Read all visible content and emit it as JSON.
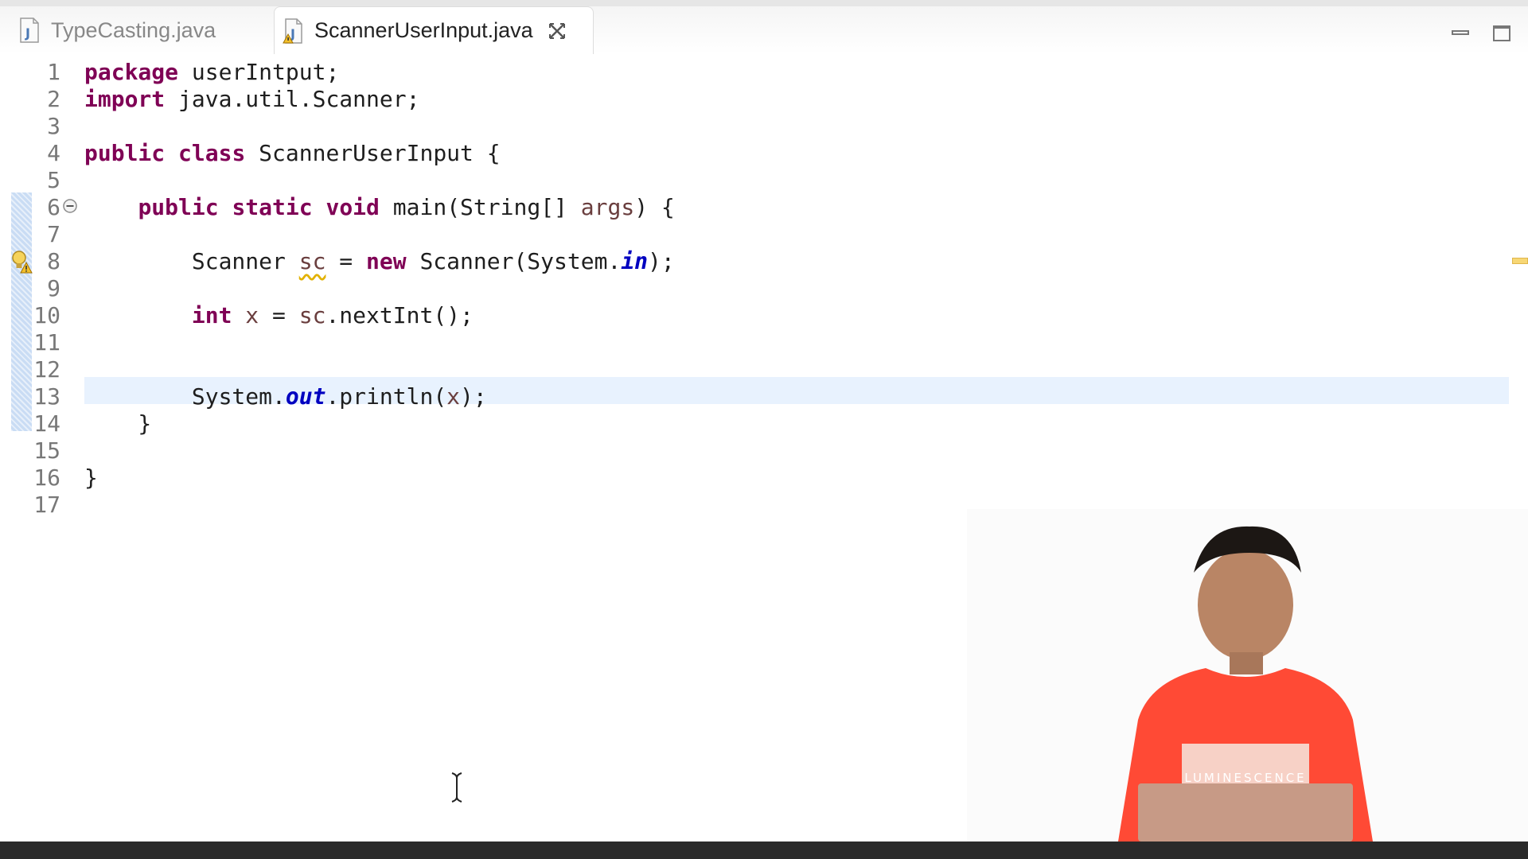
{
  "tabs": [
    {
      "label": "TypeCasting.java",
      "active": false,
      "icon": "java-file-icon"
    },
    {
      "label": "ScannerUserInput.java",
      "active": true,
      "icon": "java-file-warning-icon"
    }
  ],
  "window_controls": {
    "minimize_icon": "minimize-icon",
    "maximize_icon": "maximize-icon"
  },
  "editor": {
    "current_line": 13,
    "lines": [
      {
        "num": "1"
      },
      {
        "num": "2"
      },
      {
        "num": "3"
      },
      {
        "num": "4"
      },
      {
        "num": "5"
      },
      {
        "num": "6"
      },
      {
        "num": "7"
      },
      {
        "num": "8"
      },
      {
        "num": "9"
      },
      {
        "num": "10"
      },
      {
        "num": "11"
      },
      {
        "num": "12"
      },
      {
        "num": "13"
      },
      {
        "num": "14"
      },
      {
        "num": "15"
      },
      {
        "num": "16"
      },
      {
        "num": "17"
      }
    ],
    "code": {
      "l1": [
        "package",
        " userIntput;"
      ],
      "l2": [
        "import",
        " java.util.Scanner;"
      ],
      "l4": [
        "public",
        " ",
        "class",
        " ScannerUserInput {"
      ],
      "l6": [
        "    ",
        "public",
        " ",
        "static",
        " ",
        "void",
        " main(String[] ",
        "args",
        ") {"
      ],
      "l8": [
        "        Scanner ",
        "sc",
        " = ",
        "new",
        " Scanner(System.",
        "in",
        ");"
      ],
      "l10": [
        "        ",
        "int",
        " ",
        "x",
        " = ",
        "sc",
        ".nextInt();"
      ],
      "l13": [
        "        System.",
        "out",
        ".println(",
        "x",
        ");"
      ],
      "l14": [
        "    }"
      ],
      "l16": [
        "}"
      ]
    }
  },
  "colors": {
    "keyword": "#7f0055",
    "local_variable": "#6a3e3e",
    "static_field": "#0000c0",
    "line_number": "#787878",
    "current_line_highlight": "#e8f2fe",
    "change_ruler": "#c9dcf4"
  },
  "presenter": {
    "shirt_text": "LUMINESCENCE"
  }
}
